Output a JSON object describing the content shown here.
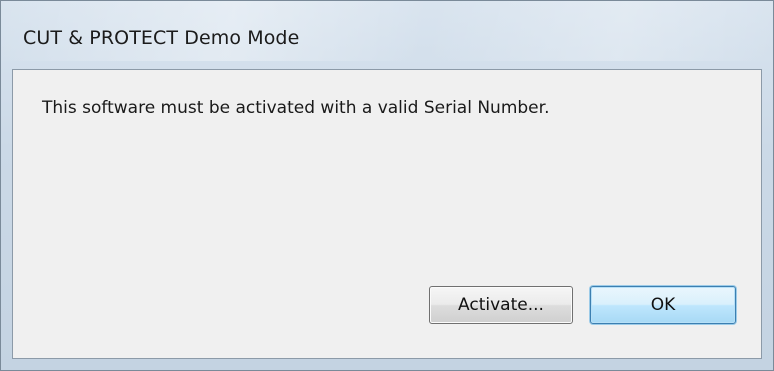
{
  "window": {
    "title": "CUT & PROTECT Demo Mode"
  },
  "dialog": {
    "message": "This software must be activated with a valid Serial Number."
  },
  "buttons": {
    "activate_label": "Activate...",
    "ok_label": "OK"
  },
  "colors": {
    "frame": "#cbd9e7",
    "client_background": "#f0f0f0",
    "default_button_border": "#3c7fb1"
  }
}
